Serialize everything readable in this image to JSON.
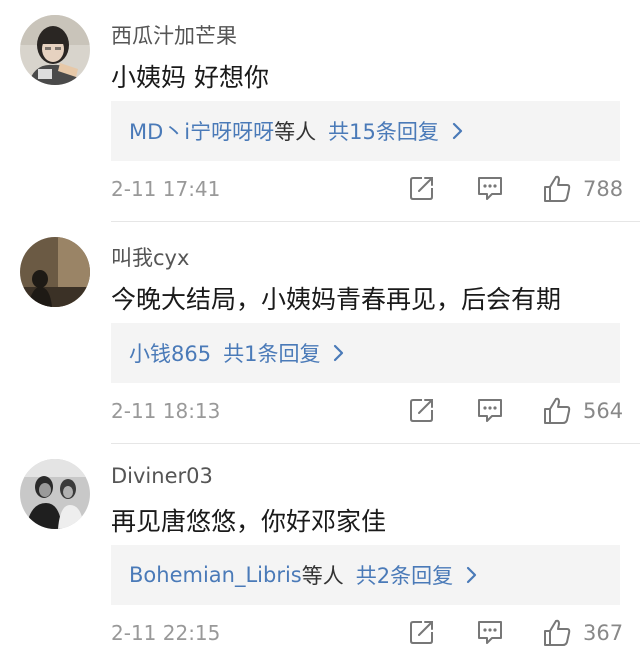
{
  "comments": [
    {
      "username": "西瓜汁加芒果",
      "text": "小姨妈 好想你",
      "reply_names": "MD丶i宁呀呀呀",
      "reply_suffix": "等人",
      "reply_count": "共15条回复",
      "time": "2-11 17:41",
      "likes": "788"
    },
    {
      "username": "叫我cyx",
      "text": "今晚大结局，小姨妈青春再见，后会有期",
      "reply_names": "小钱865",
      "reply_suffix": "",
      "reply_count": "共1条回复",
      "time": "2-11 18:13",
      "likes": "564"
    },
    {
      "username": "Diviner03",
      "text": "再见唐悠悠，你好邓家佳",
      "reply_names": "Bohemian_Libris",
      "reply_suffix": "等人",
      "reply_count": "共2条回复",
      "time": "2-11 22:15",
      "likes": "367"
    }
  ],
  "icons": {
    "share": "share-icon",
    "comment": "comment-icon",
    "like": "thumbs-up-icon",
    "chevron": "chevron-right-icon"
  },
  "colors": {
    "link": "#4a7ab8",
    "reply_bg": "#f4f4f4",
    "meta": "#999999"
  }
}
